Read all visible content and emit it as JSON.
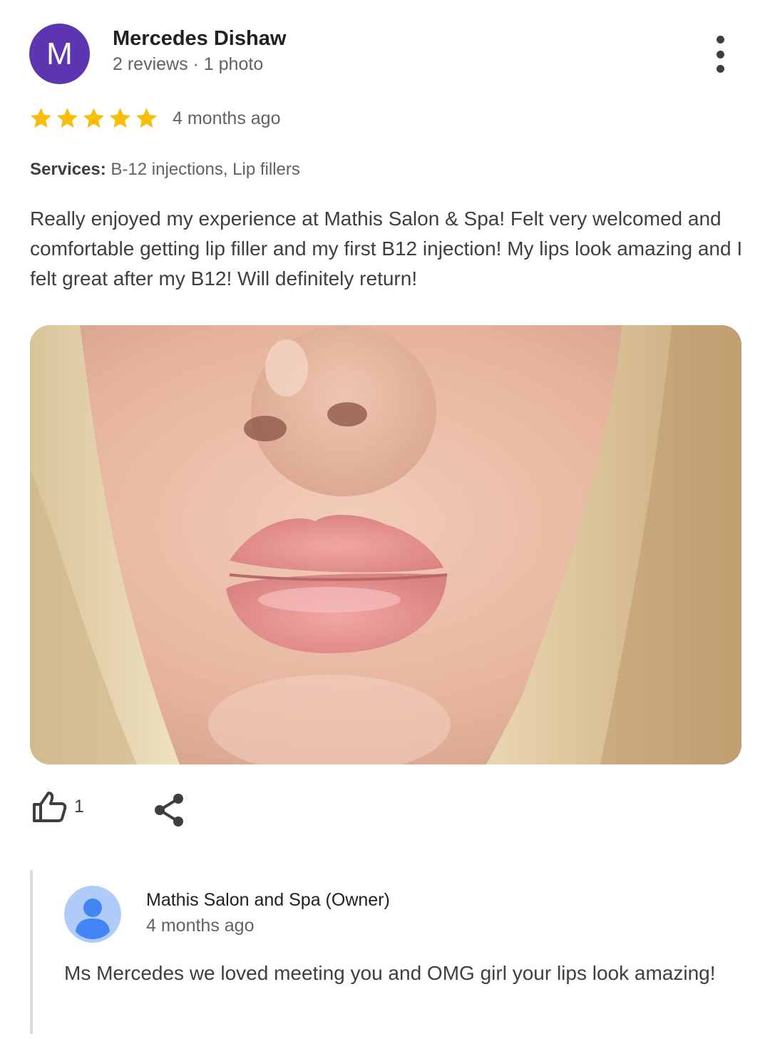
{
  "review": {
    "avatar_letter": "M",
    "avatar_color": "#5e35b1",
    "reviewer_name": "Mercedes Dishaw",
    "reviewer_meta": "2 reviews · 1 photo",
    "rating": 5,
    "rating_max": 5,
    "star_color": "#fbbc04",
    "time": "4 months ago",
    "services_label": "Services:",
    "services_value": "B-12 injections, Lip fillers",
    "text": "Really enjoyed my experience at Mathis Salon & Spa! Felt very welcomed and comfortable getting lip filler and my first B12 injection! My lips look amazing and I felt great after my B12! Will definitely return!",
    "more_icon": "more-vert-icon"
  },
  "actions": {
    "like_icon": "thumb-up-icon",
    "like_count": "1",
    "share_icon": "share-icon"
  },
  "owner_reply": {
    "avatar_icon": "person-icon",
    "avatar_color": "#4285f4",
    "name": "Mathis Salon and Spa (Owner)",
    "time": "4 months ago",
    "text": "Ms Mercedes we loved meeting you and OMG girl your lips look amazing!"
  }
}
